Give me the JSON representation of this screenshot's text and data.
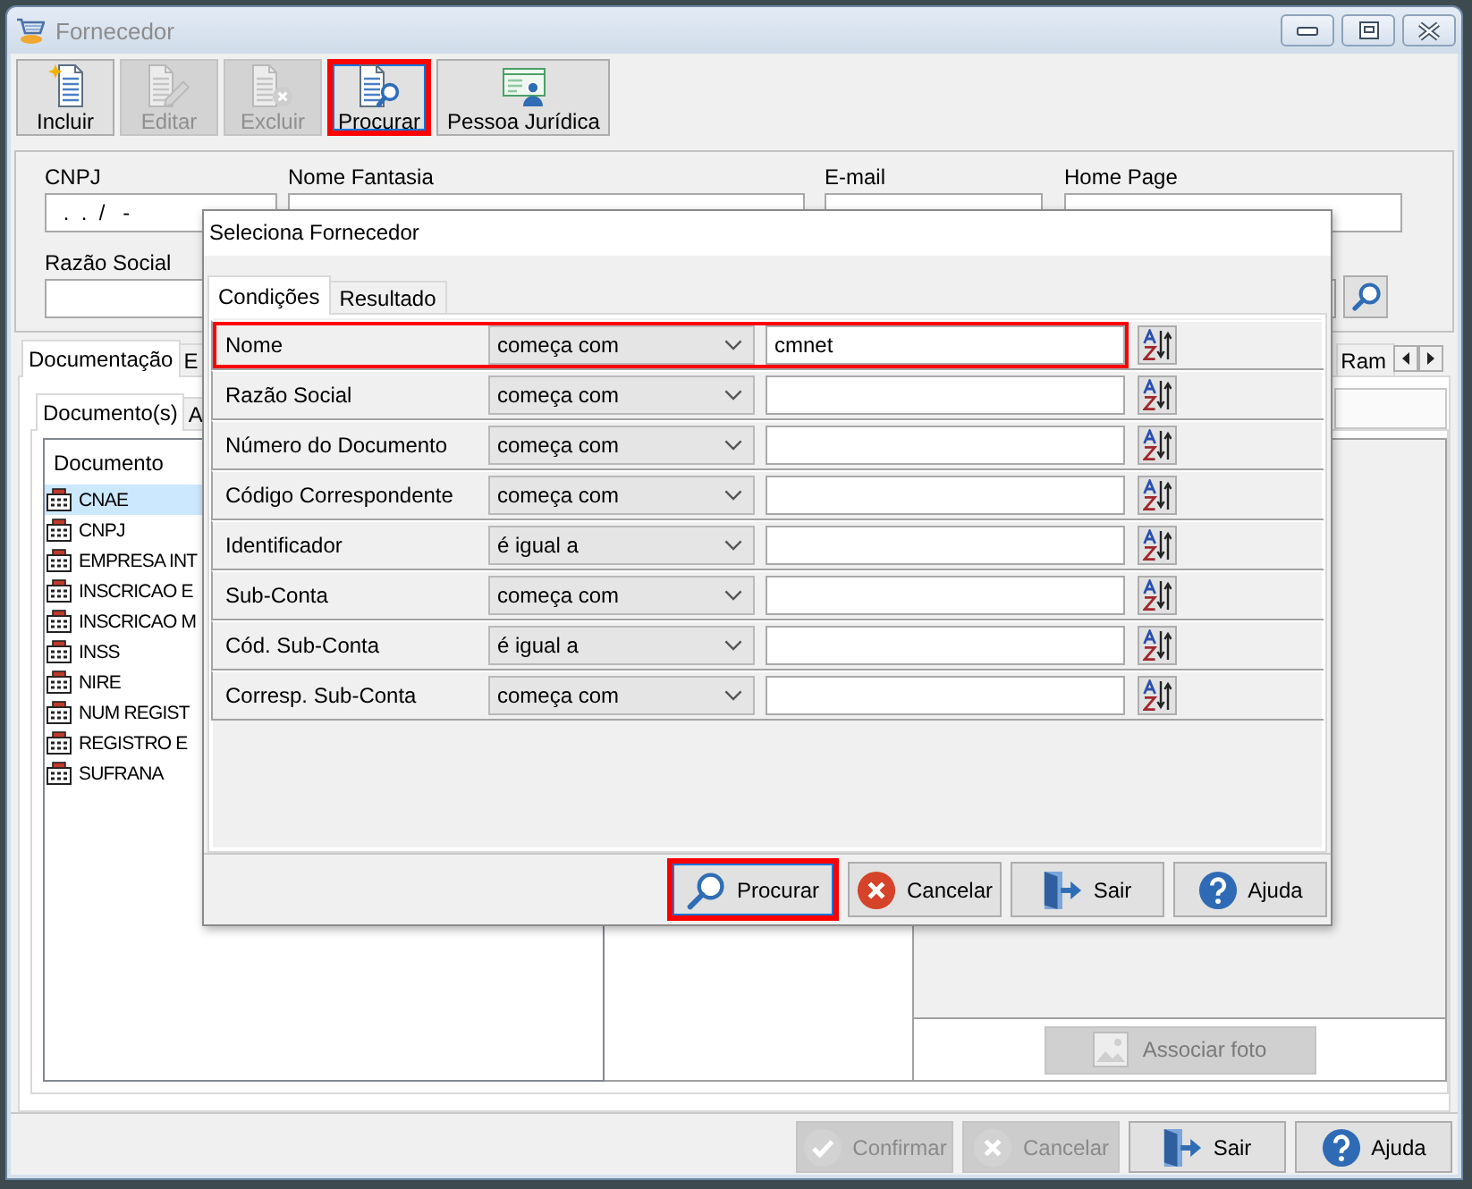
{
  "window": {
    "title": "Fornecedor",
    "active": false
  },
  "toolbar": [
    {
      "kind": "new",
      "label": "Incluir",
      "disabled": false,
      "highlighted": false
    },
    {
      "kind": "edit",
      "label": "Editar",
      "disabled": true,
      "highlighted": false
    },
    {
      "kind": "delete",
      "label": "Excluir",
      "disabled": true,
      "highlighted": false
    },
    {
      "kind": "search",
      "label": "Procurar",
      "disabled": false,
      "highlighted": true
    },
    {
      "kind": "company",
      "label": "Pessoa Jurídica",
      "disabled": false,
      "highlighted": false
    }
  ],
  "form": {
    "cnpj": {
      "label": "CNPJ",
      "value": " .  .  /   -"
    },
    "nome_fantasia": {
      "label": "Nome Fantasia"
    },
    "email": {
      "label": "E-mail"
    },
    "home_page": {
      "label": "Home Page"
    },
    "razao_social": {
      "label": "Razão Social"
    }
  },
  "tabs": [
    {
      "label": "Documentação",
      "selected": true
    },
    {
      "label": "E",
      "selected": false
    }
  ],
  "tabs_right": [
    {
      "label": "Ram",
      "selected": false
    }
  ],
  "subtabs": [
    {
      "label": "Documento(s)",
      "selected": true
    },
    {
      "label": "A",
      "selected": false
    }
  ],
  "document_list": {
    "column": "Documento",
    "items": [
      {
        "label": "CNAE",
        "selected": true
      },
      {
        "label": "CNPJ",
        "selected": false
      },
      {
        "label": "EMPRESA INT",
        "selected": false
      },
      {
        "label": "INSCRICAO E",
        "selected": false
      },
      {
        "label": "INSCRICAO M",
        "selected": false
      },
      {
        "label": "INSS",
        "selected": false
      },
      {
        "label": "NIRE",
        "selected": false
      },
      {
        "label": "NUM REGIST",
        "selected": false
      },
      {
        "label": "REGISTRO E",
        "selected": false
      },
      {
        "label": "SUFRANA",
        "selected": false
      }
    ]
  },
  "photo_button": {
    "label": "Associar foto",
    "disabled": true
  },
  "footer_buttons": [
    {
      "kind": "confirm",
      "label": "Confirmar",
      "disabled": true
    },
    {
      "kind": "cancel",
      "label": "Cancelar",
      "disabled": true
    },
    {
      "kind": "exit",
      "label": "Sair",
      "disabled": false
    },
    {
      "kind": "help",
      "label": "Ajuda",
      "disabled": false
    }
  ],
  "dialog": {
    "title": "Seleciona Fornecedor",
    "tabs": [
      {
        "label": "Condições",
        "selected": true
      },
      {
        "label": "Resultado",
        "selected": false
      }
    ],
    "conditions": [
      {
        "field": "Nome",
        "operator": "começa com",
        "value": "cmnet",
        "highlighted": true
      },
      {
        "field": "Razão Social",
        "operator": "começa com",
        "highlighted": false
      },
      {
        "field": "Número do Documento",
        "operator": "começa com",
        "highlighted": false
      },
      {
        "field": "Código Correspondente",
        "operator": "começa com",
        "highlighted": false
      },
      {
        "field": "Identificador",
        "operator": "é igual a",
        "highlighted": false
      },
      {
        "field": "Sub-Conta",
        "operator": "começa com",
        "highlighted": false
      },
      {
        "field": "Cód. Sub-Conta",
        "operator": "é igual a",
        "highlighted": false
      },
      {
        "field": "Corresp. Sub-Conta",
        "operator": "começa com",
        "highlighted": false
      }
    ],
    "buttons": [
      {
        "kind": "search",
        "label": "Procurar",
        "highlighted": true
      },
      {
        "kind": "cancel",
        "label": "Cancelar",
        "highlighted": false
      },
      {
        "kind": "exit",
        "label": "Sair",
        "highlighted": false
      },
      {
        "kind": "help",
        "label": "Ajuda",
        "highlighted": false
      }
    ]
  }
}
